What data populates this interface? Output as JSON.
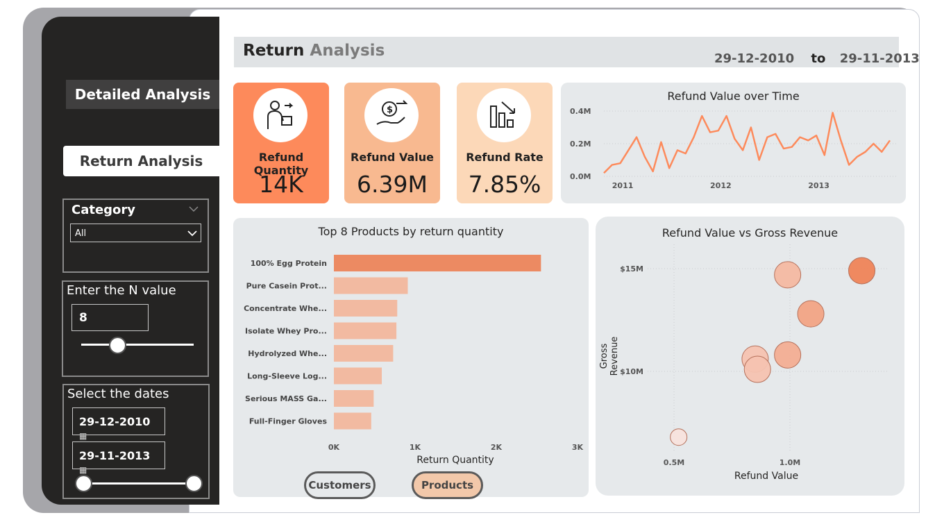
{
  "sidebar": {
    "nav_detailed": "Detailed Analysis",
    "nav_return": "Return Analysis",
    "category": {
      "title": "Category",
      "selected": "All"
    },
    "n_value": {
      "title": "Enter the N value",
      "value": "8",
      "slider_fraction": 0.32
    },
    "dates": {
      "title": "Select the dates",
      "start": "29-12-2010",
      "end": "29-11-2013"
    }
  },
  "header": {
    "title_bold": "Return",
    "title_light": "Analysis",
    "date_from": "29-12-2010",
    "date_to_word": "to",
    "date_to": "29-11-2013"
  },
  "kpis": [
    {
      "label": "Refund Quantity",
      "value": "14K",
      "color": "#fd8a5b"
    },
    {
      "label": "Refund Value",
      "value": "6.39M",
      "color": "#f8b990"
    },
    {
      "label": "Refund Rate",
      "value": "7.85%",
      "color": "#fcd8b8"
    }
  ],
  "colors": {
    "accent": "#fd8a5b",
    "bar_primary": "#ec8a62",
    "bar_secondary": "#f2baa1",
    "sidebar": "#252423",
    "card": "#e6e9eb"
  },
  "chart_data": [
    {
      "type": "line",
      "title": "Refund Value over Time",
      "x_ticks": [
        "2011",
        "2012",
        "2013"
      ],
      "y_ticks": [
        "0.0M",
        "0.2M",
        "0.4M"
      ],
      "ylim": [
        0,
        0.4
      ],
      "x": [
        "2010-12",
        "2011-01",
        "2011-02",
        "2011-03",
        "2011-04",
        "2011-05",
        "2011-06",
        "2011-07",
        "2011-08",
        "2011-09",
        "2011-10",
        "2011-11",
        "2011-12",
        "2012-01",
        "2012-02",
        "2012-03",
        "2012-04",
        "2012-05",
        "2012-06",
        "2012-07",
        "2012-08",
        "2012-09",
        "2012-10",
        "2012-11",
        "2012-12",
        "2013-01",
        "2013-02",
        "2013-03",
        "2013-04",
        "2013-05",
        "2013-06",
        "2013-07",
        "2013-08",
        "2013-09",
        "2013-10",
        "2013-11"
      ],
      "values": [
        0.02,
        0.07,
        0.08,
        0.16,
        0.24,
        0.12,
        0.03,
        0.21,
        0.05,
        0.16,
        0.14,
        0.24,
        0.37,
        0.27,
        0.28,
        0.37,
        0.23,
        0.16,
        0.3,
        0.1,
        0.24,
        0.26,
        0.17,
        0.18,
        0.24,
        0.22,
        0.25,
        0.13,
        0.39,
        0.22,
        0.07,
        0.12,
        0.15,
        0.2,
        0.15,
        0.22
      ],
      "color": "#fd8a5b"
    },
    {
      "type": "bar",
      "orientation": "horizontal",
      "title": "Top 8 Products by return quantity",
      "xlabel": "Return Quantity",
      "x_ticks": [
        "0K",
        "1K",
        "2K",
        "3K"
      ],
      "xlim": [
        0,
        3000
      ],
      "categories": [
        "100% Egg Protein",
        "Pure Casein Prot...",
        "Concentrate Whe...",
        "Isolate Whey Pro...",
        "Hydrolyzed Whe...",
        "Long-Sleeve Log...",
        "Serious MASS Ga...",
        "Full-Finger Gloves"
      ],
      "values": [
        2550,
        910,
        780,
        770,
        730,
        590,
        490,
        460
      ]
    },
    {
      "type": "scatter",
      "title": "Refund Value vs Gross Revenue",
      "xlabel": "Refund Value",
      "ylabel": "Gross Revenue",
      "x_ticks": [
        "0.5M",
        "1.0M"
      ],
      "y_ticks": [
        "$10M",
        "$15M"
      ],
      "points": [
        {
          "x": 0.52,
          "y": 6.8,
          "intensity": 0.05
        },
        {
          "x": 0.85,
          "y": 10.6,
          "intensity": 0.35
        },
        {
          "x": 0.86,
          "y": 10.1,
          "intensity": 0.35
        },
        {
          "x": 0.99,
          "y": 10.8,
          "intensity": 0.55
        },
        {
          "x": 0.99,
          "y": 14.7,
          "intensity": 0.45
        },
        {
          "x": 1.09,
          "y": 12.8,
          "intensity": 0.65
        },
        {
          "x": 1.31,
          "y": 14.9,
          "intensity": 0.95
        }
      ]
    }
  ],
  "toggles": {
    "customers": "Customers",
    "products": "Products"
  }
}
